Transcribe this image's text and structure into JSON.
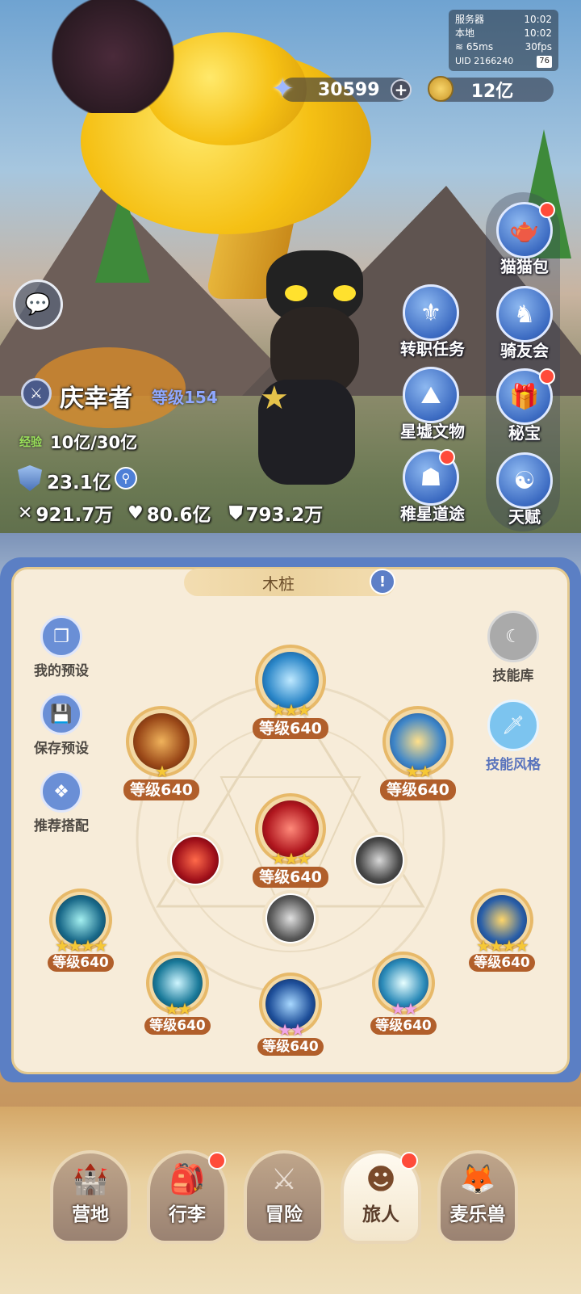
{
  "status": {
    "server_label": "服务器",
    "server_time": "10:02",
    "local_label": "本地",
    "local_time": "10:02",
    "ping": "65ms",
    "fps": "30fps",
    "uid": "UID 2166240",
    "battery": "76"
  },
  "currency": {
    "stars": "30599",
    "gold": "12亿"
  },
  "side_buttons": {
    "cat_bag": "猫猫包",
    "job_quest": "转职任务",
    "rider_club": "骑友会",
    "relics": "星墟文物",
    "secret": "秘宝",
    "star_path": "稚星道途",
    "talent": "天赋"
  },
  "player": {
    "name": "庆幸者",
    "level": "等级154",
    "exp_label": "经验",
    "exp_value": "10亿/30亿",
    "power": "23.1亿",
    "attack": "921.7万",
    "hp": "80.6亿",
    "defense": "793.2万"
  },
  "skill_panel": {
    "title": "木桩",
    "my_presets": "我的预设",
    "save_preset": "保存预设",
    "recommended": "推荐搭配",
    "skill_library": "技能库",
    "skill_style": "技能风格",
    "skills": [
      {
        "level": "等级640",
        "stars": "★★★"
      },
      {
        "level": "等级640",
        "stars": "★"
      },
      {
        "level": "等级640",
        "stars": "★★"
      },
      {
        "level": "等级640",
        "stars": "★★★"
      },
      {
        "level": "等级640",
        "stars": "★★★★"
      },
      {
        "level": "等级640",
        "stars": "★★★★"
      },
      {
        "level": "等级640",
        "stars": "★★"
      },
      {
        "level": "等级640",
        "stars": "★★"
      },
      {
        "level": "等级640",
        "stars": "★★"
      }
    ]
  },
  "nav": {
    "camp": "营地",
    "luggage": "行李",
    "adventure": "冒险",
    "traveler": "旅人",
    "pets": "麦乐兽"
  },
  "colors": {
    "accent_blue": "#5b7fc4",
    "level_badge": "#b15f2b",
    "star_gold": "#f6c836",
    "red_dot": "#ff4b3a"
  }
}
